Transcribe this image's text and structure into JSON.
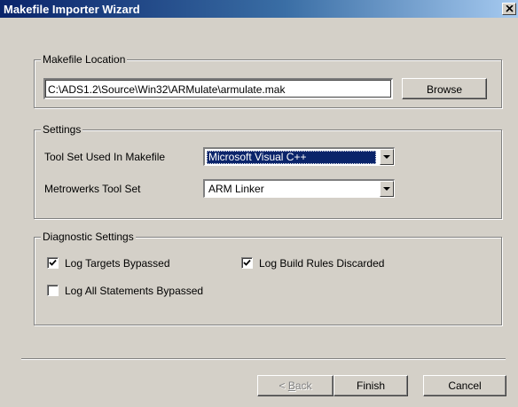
{
  "window": {
    "title": "Makefile Importer Wizard"
  },
  "makefile_location": {
    "legend": "Makefile Location",
    "path_value": "C:\\ADS1.2\\Source\\Win32\\ARMulate\\armulate.mak",
    "browse_label": "Browse"
  },
  "settings": {
    "legend": "Settings",
    "tool_set_label": "Tool Set Used In Makefile",
    "tool_set_value": "Microsoft Visual C++",
    "metrowerks_label": "Metrowerks Tool Set",
    "metrowerks_value": "ARM Linker"
  },
  "diagnostic": {
    "legend": "Diagnostic Settings",
    "log_targets_bypassed": {
      "label": "Log Targets Bypassed",
      "checked": true
    },
    "log_build_rules_discarded": {
      "label": "Log Build Rules Discarded",
      "checked": true
    },
    "log_all_statements_bypassed": {
      "label": "Log All Statements Bypassed",
      "checked": false
    }
  },
  "buttons": {
    "back_label": "< Back",
    "finish_label": "Finish",
    "cancel_label": "Cancel"
  },
  "icons": {
    "close": "close-icon",
    "dropdown": "chevron-down-icon",
    "check": "checkmark-icon"
  }
}
